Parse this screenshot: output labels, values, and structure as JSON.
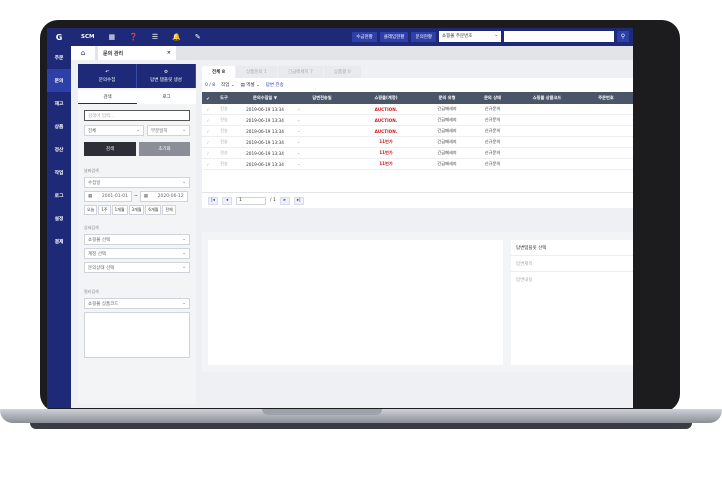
{
  "topbar": {
    "logo": "G",
    "scm": "SCM",
    "nav_buttons": [
      "수금현황",
      "클레임현황",
      "문의현황"
    ],
    "search_type": "쇼핑몰 주문번호",
    "search_value": ""
  },
  "leftnav": [
    "주문",
    "문의",
    "재고",
    "상품",
    "정산",
    "작업",
    "로그",
    "설정",
    "결제"
  ],
  "page_tab": {
    "title": "문의 관리",
    "close": "×"
  },
  "actions": [
    {
      "icon": "↶",
      "label": "문의수집"
    },
    {
      "icon": "⚙",
      "label": "답변 템플릿 생성"
    }
  ],
  "subtabs": [
    "검색",
    "로그"
  ],
  "filters": {
    "search_placeholder": "검색어 입력...",
    "scope": "전체",
    "match": "부분일치",
    "search_btn": "검색",
    "reset_btn": "초기화",
    "date_label": "날짜검색",
    "date_type": "수집일",
    "date_from": "2001-01-01",
    "date_sep": "~",
    "date_to": "2020-06-12",
    "periods": [
      "오늘",
      "1주",
      "1개월",
      "3개월",
      "6개월",
      "전체"
    ],
    "detail_label": "상세검색",
    "mall_select": "쇼핑몰 선택",
    "account_select": "계정 선택",
    "status_select": "문의상태 선택",
    "multi_label": "멀티검색",
    "multi_select": "쇼핑몰 상품코드"
  },
  "count_tabs": [
    {
      "label": "전체",
      "count": "8"
    },
    {
      "label": "상품문의",
      "count": "1"
    },
    {
      "label": "긴급메세지",
      "count": "7"
    },
    {
      "label": "상품평",
      "count": "0"
    }
  ],
  "toolbar": {
    "selection": "0 / 8",
    "work": "작업",
    "excel": "엑셀",
    "reply": "답변 전송"
  },
  "columns": [
    "",
    "도구",
    "문의수집일 ▼",
    "답변전송일",
    "쇼핑몰(계정)",
    "문의 유형",
    "문의 상태",
    "쇼핑몰 상품코드",
    "주문번호"
  ],
  "rows": [
    {
      "tool": "전송",
      "date": "2019-06-19 13:34",
      "sent": "-",
      "mall": "AUCTION.",
      "type": "긴급메세지",
      "status": "신규문의"
    },
    {
      "tool": "전송",
      "date": "2019-06-19 13:34",
      "sent": "-",
      "mall": "AUCTION.",
      "type": "긴급메세지",
      "status": "신규문의"
    },
    {
      "tool": "전송",
      "date": "2019-06-19 13:34",
      "sent": "-",
      "mall": "AUCTION.",
      "type": "긴급메세지",
      "status": "신규문의"
    },
    {
      "tool": "전송",
      "date": "2019-06-19 13:34",
      "sent": "-",
      "mall": "11번가",
      "type": "긴급메세지",
      "status": "신규문의"
    },
    {
      "tool": "전송",
      "date": "2019-06-19 13:34",
      "sent": "-",
      "mall": "11번가",
      "type": "긴급메세지",
      "status": "신규문의"
    },
    {
      "tool": "전송",
      "date": "2019-06-19 13:34",
      "sent": "-",
      "mall": "11번가",
      "type": "긴급메세지",
      "status": "신규문의"
    }
  ],
  "pager": {
    "page": "1",
    "total": "/ 1"
  },
  "detail": {
    "template": "답변템플릿 선택",
    "reply_title": "답변제목",
    "reply_body": "답변내용"
  }
}
